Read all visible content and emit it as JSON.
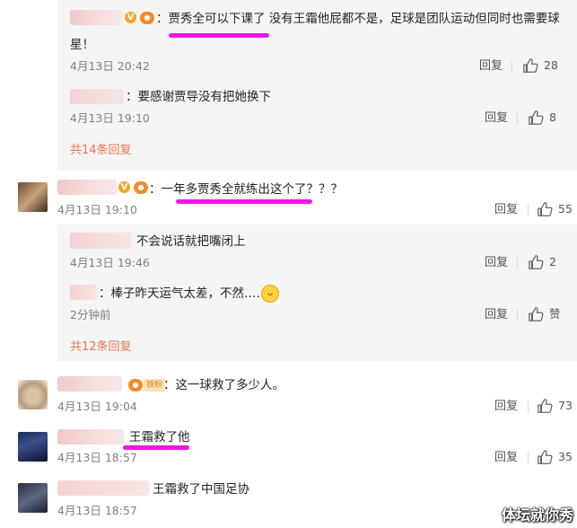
{
  "ui": {
    "reply_label": "回复",
    "expand_14": "共14条回复",
    "expand_12": "共12条回复"
  },
  "comments": [
    {
      "text": "：贾秀全可以下课了 没有王霜他屁都不是，足球是团队运动但同时也需要球",
      "text2": "星！",
      "time": "4月13日 20:42",
      "likes": "28"
    },
    {
      "text": "：要感谢贾导没有把她换下",
      "time": "4月13日 19:10",
      "likes": "8"
    },
    {
      "text": "：一年多贾秀全就练出这个了？？？",
      "time": "4月13日 19:10",
      "likes": "55"
    },
    {
      "text": "不会说话就把嘴闭上",
      "time": "4月13日 19:46",
      "likes": "2"
    },
    {
      "text": "：棒子昨天运气太差，不然……",
      "time": "2分钟前",
      "likes": "赞"
    },
    {
      "text": "：这一球救了多少人。",
      "time": "4月13日 19:04",
      "likes": "73",
      "badge": "铁粉"
    },
    {
      "text": "王霜救了他",
      "time": "4月13日 18:57",
      "likes": "35"
    },
    {
      "text": "王霜救了中国足协",
      "time": "4月13日 18:57"
    }
  ],
  "watermark": "体坛就你秀"
}
